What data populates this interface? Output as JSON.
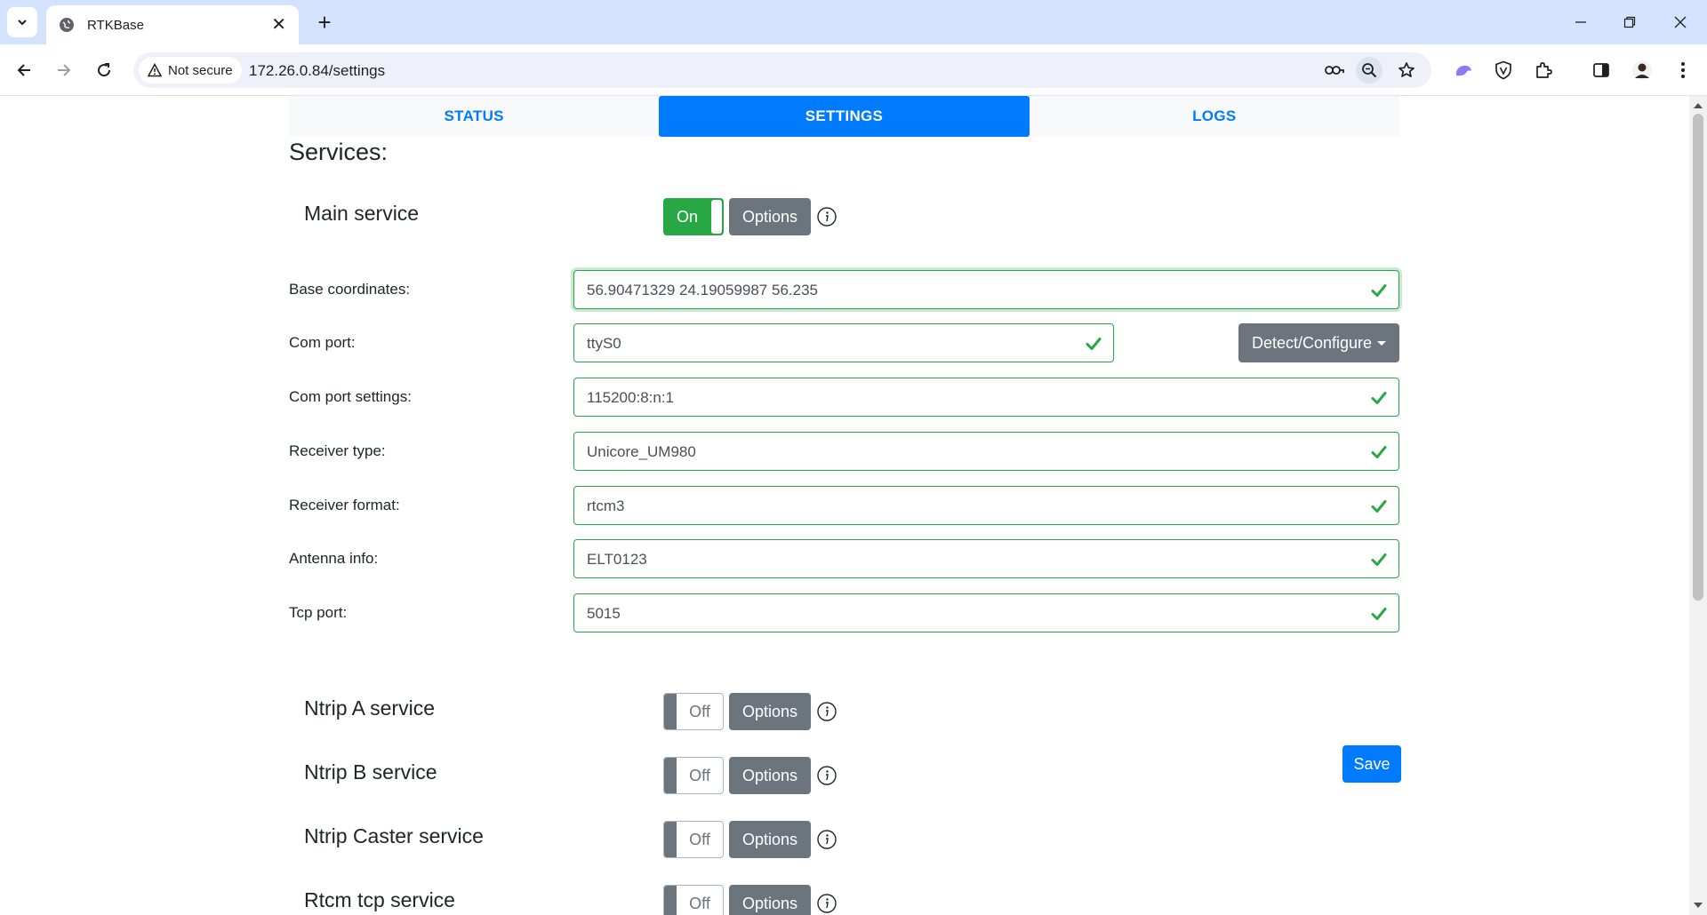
{
  "browser": {
    "tab_title": "RTKBase",
    "security_chip": "Not secure",
    "url": "172.26.0.84/settings"
  },
  "nav": {
    "tabs": [
      {
        "label": "STATUS",
        "active": false
      },
      {
        "label": "SETTINGS",
        "active": true
      },
      {
        "label": "LOGS",
        "active": false
      }
    ]
  },
  "page": {
    "services_title": "Services:"
  },
  "main_service": {
    "label": "Main service",
    "state": "On",
    "options_label": "Options"
  },
  "form": {
    "base_coordinates": {
      "label": "Base coordinates:",
      "value": "56.90471329 24.19059987 56.235"
    },
    "com_port": {
      "label": "Com port:",
      "value": "ttyS0",
      "button_label": "Detect/Configure"
    },
    "com_port_settings": {
      "label": "Com port settings:",
      "value": "115200:8:n:1"
    },
    "receiver_type": {
      "label": "Receiver type:",
      "value": "Unicore_UM980"
    },
    "receiver_format": {
      "label": "Receiver format:",
      "value": "rtcm3"
    },
    "antenna_info": {
      "label": "Antenna info:",
      "value": "ELT0123"
    },
    "tcp_port": {
      "label": "Tcp port:",
      "value": "5015"
    },
    "save_label": "Save"
  },
  "services": [
    {
      "label": "Ntrip A service",
      "state": "Off",
      "options_label": "Options"
    },
    {
      "label": "Ntrip B service",
      "state": "Off",
      "options_label": "Options"
    },
    {
      "label": "Ntrip Caster service",
      "state": "Off",
      "options_label": "Options"
    },
    {
      "label": "Rtcm tcp service",
      "state": "Off",
      "options_label": "Options"
    }
  ],
  "colors": {
    "primary": "#007bff",
    "success": "#28a745",
    "secondary": "#6c757d",
    "chrome_tabstrip": "#d3e3fd"
  }
}
